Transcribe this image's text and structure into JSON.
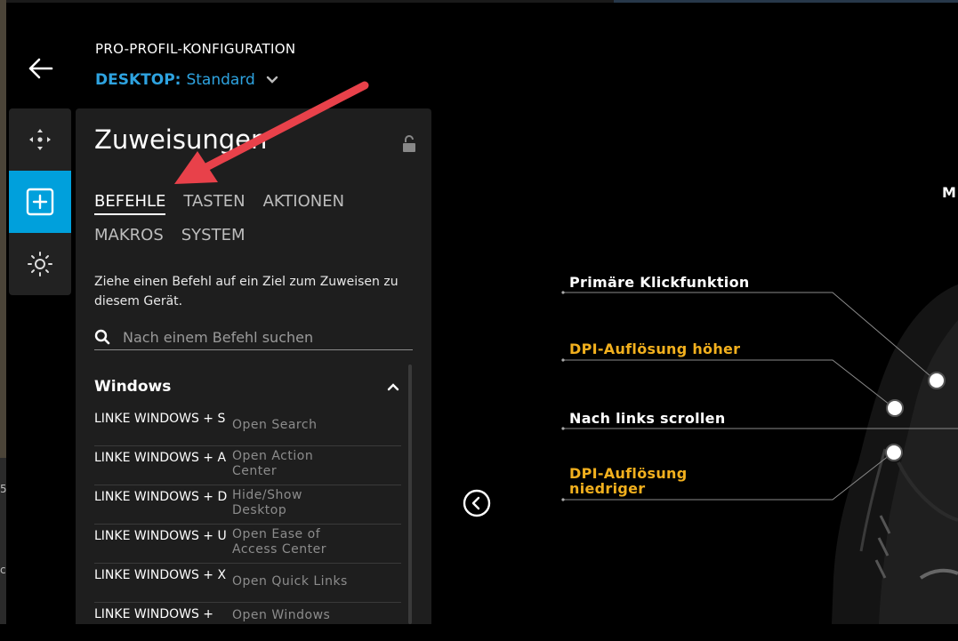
{
  "header": {
    "title": "PRO-PROFIL-KONFIGURATION",
    "profile_prefix": "DESKTOP:",
    "profile_name": "Standard"
  },
  "nav": {
    "items": [
      "move-icon",
      "add-assignment-icon",
      "lighting-icon"
    ],
    "active_index": 1
  },
  "panel": {
    "title": "Zuweisungen",
    "tabs": [
      "BEFEHLE",
      "TASTEN",
      "AKTIONEN",
      "MAKROS",
      "SYSTEM"
    ],
    "active_tab": "BEFEHLE",
    "hint": "Ziehe einen Befehl auf ein Ziel zum Zuweisen zu diesem Gerät.",
    "search_placeholder": "Nach einem Befehl suchen",
    "section": "Windows",
    "commands": [
      {
        "key": "LINKE WINDOWS + S",
        "action": "Open Search"
      },
      {
        "key": "LINKE WINDOWS + A",
        "action": "Open Action Center"
      },
      {
        "key": "LINKE WINDOWS + D",
        "action": "Hide/Show Desktop"
      },
      {
        "key": "LINKE WINDOWS + U",
        "action": "Open Ease of Access Center"
      },
      {
        "key": "LINKE WINDOWS + X",
        "action": "Open Quick Links"
      },
      {
        "key": "LINKE WINDOWS +",
        "action": "Open Windows"
      }
    ]
  },
  "mouse": {
    "primary_click": "Primäre Klickfunktion",
    "dpi_up": "DPI-Auflösung höher",
    "scroll_left": "Nach links scrollen",
    "dpi_down_line1": "DPI-Auflösung",
    "dpi_down_line2": "niedriger",
    "cut_label": "M"
  },
  "edge_digits": [
    "5",
    "c"
  ],
  "colors": {
    "accent": "#00a0dc",
    "profile_blue": "#2ea3e0",
    "gold": "#f2b01e",
    "annotation_arrow": "#e8414a"
  }
}
